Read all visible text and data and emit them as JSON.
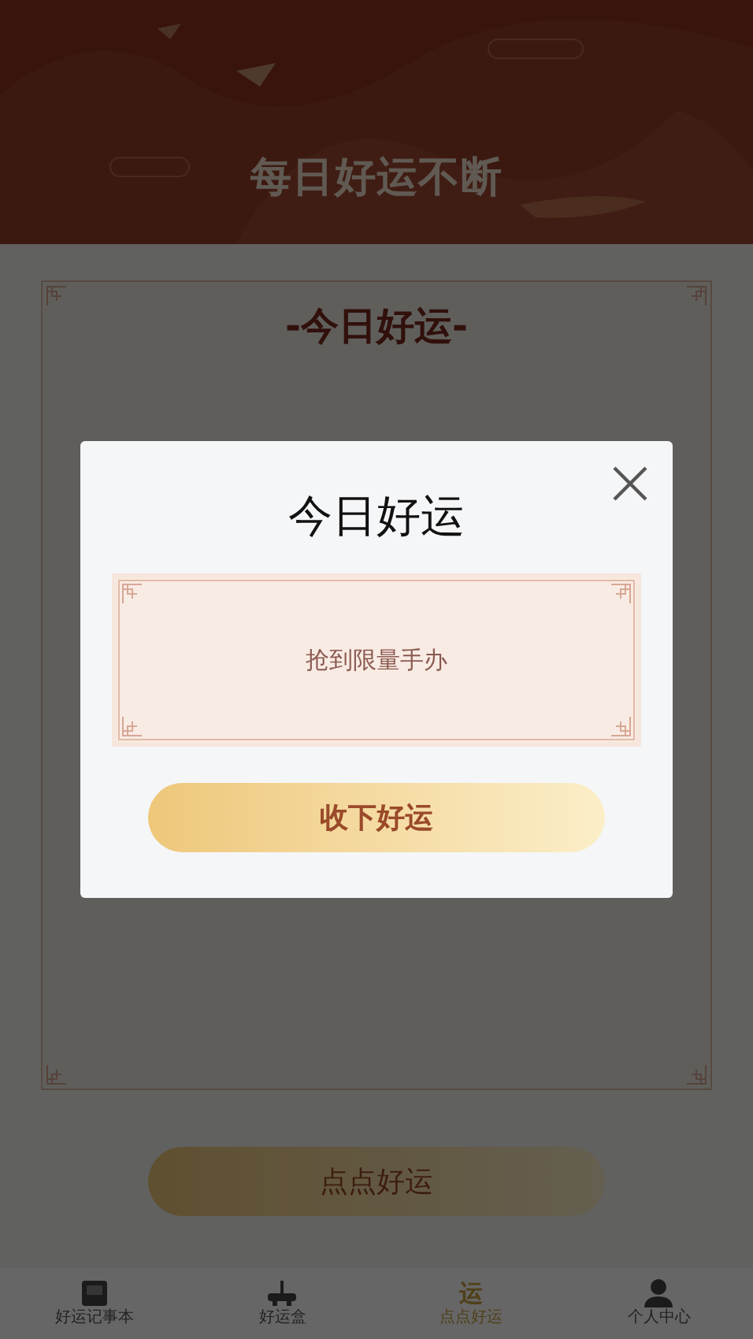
{
  "header": {
    "title": "每日好运不断"
  },
  "card": {
    "title": "-今日好运-"
  },
  "main_button": {
    "label": "点点好运"
  },
  "nav": [
    {
      "kind": "notebook",
      "label": "好运记事本",
      "selected": false
    },
    {
      "kind": "joystick",
      "label": "好运盒",
      "selected": false
    },
    {
      "kind": "glyph",
      "glyph": "运",
      "label": "点点好运",
      "selected": true
    },
    {
      "kind": "person",
      "label": "个人中心",
      "selected": false
    }
  ],
  "dialog": {
    "title": "今日好运",
    "message": "抢到限量手办",
    "confirm": "收下好运"
  }
}
